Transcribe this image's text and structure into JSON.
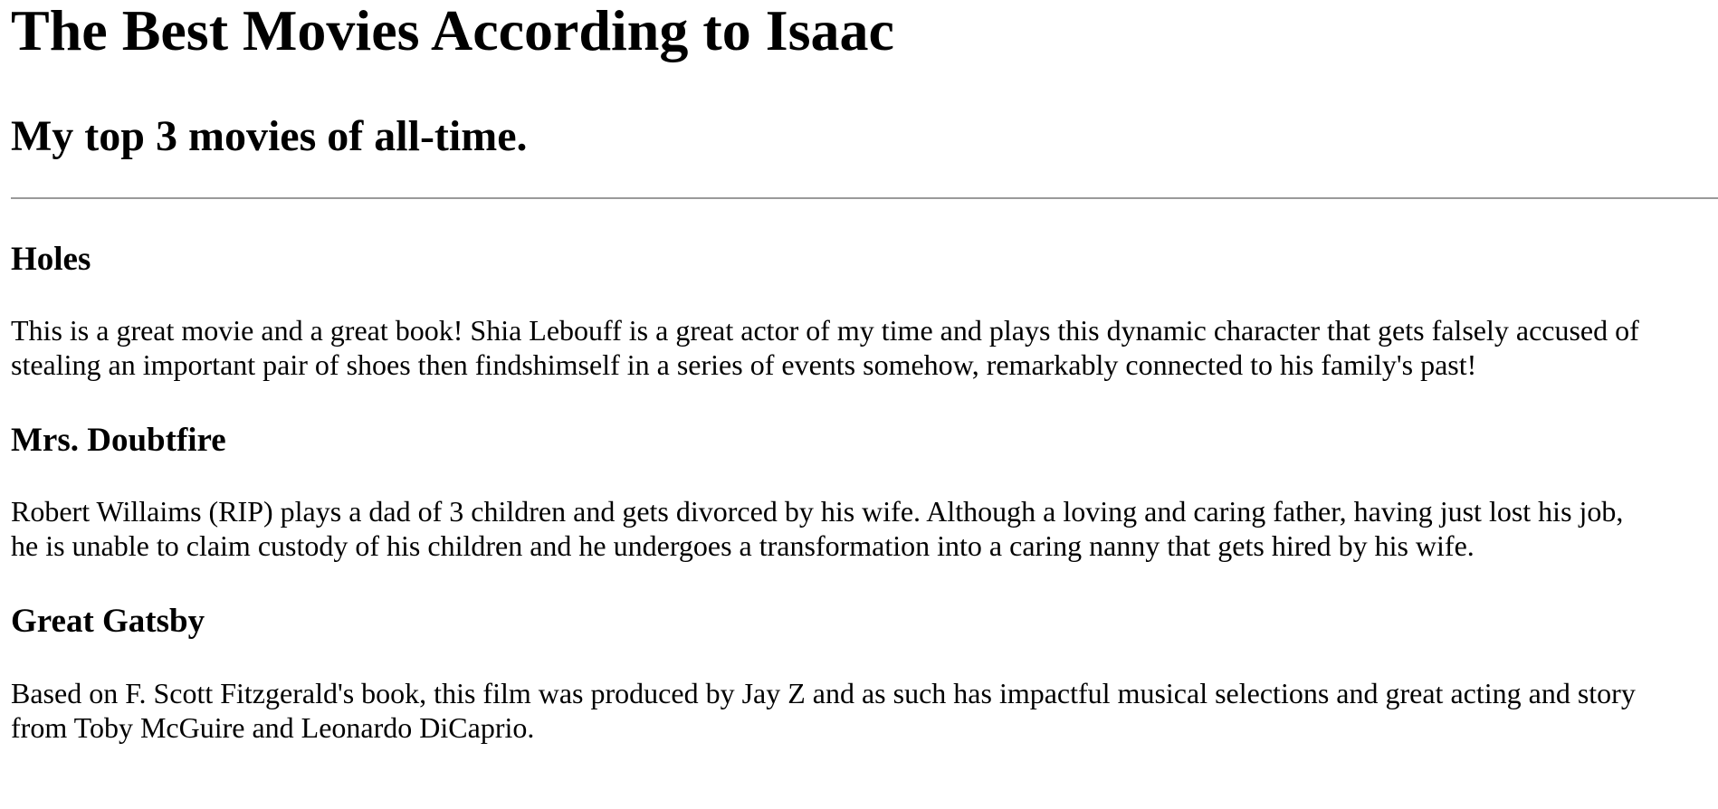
{
  "page": {
    "title": "The Best Movies According to Isaac",
    "subtitle": "My top 3 movies of all-time."
  },
  "movies": [
    {
      "title": "Holes",
      "description_line1": "This is a great movie and a great book! Shia Lebouff is a great actor of my time and plays this dynamic character that gets falsely accused of",
      "description_line2": "stealing an important pair of shoes then findshimself in a series of events somehow, remarkably connected to his family's past!"
    },
    {
      "title": "Mrs. Doubtfire",
      "description_line1": "Robert Willaims (RIP) plays a dad of 3 children and gets divorced by his wife. Although a loving and caring father, having just lost his job,",
      "description_line2": "he is unable to claim custody of his children and he undergoes a transformation into a caring nanny that gets hired by his wife."
    },
    {
      "title": "Great Gatsby",
      "description_line1": "Based on F. Scott Fitzgerald's book, this film was produced by Jay Z and as such has impactful musical selections and great acting and story",
      "description_line2": "from Toby McGuire and Leonardo DiCaprio."
    }
  ]
}
